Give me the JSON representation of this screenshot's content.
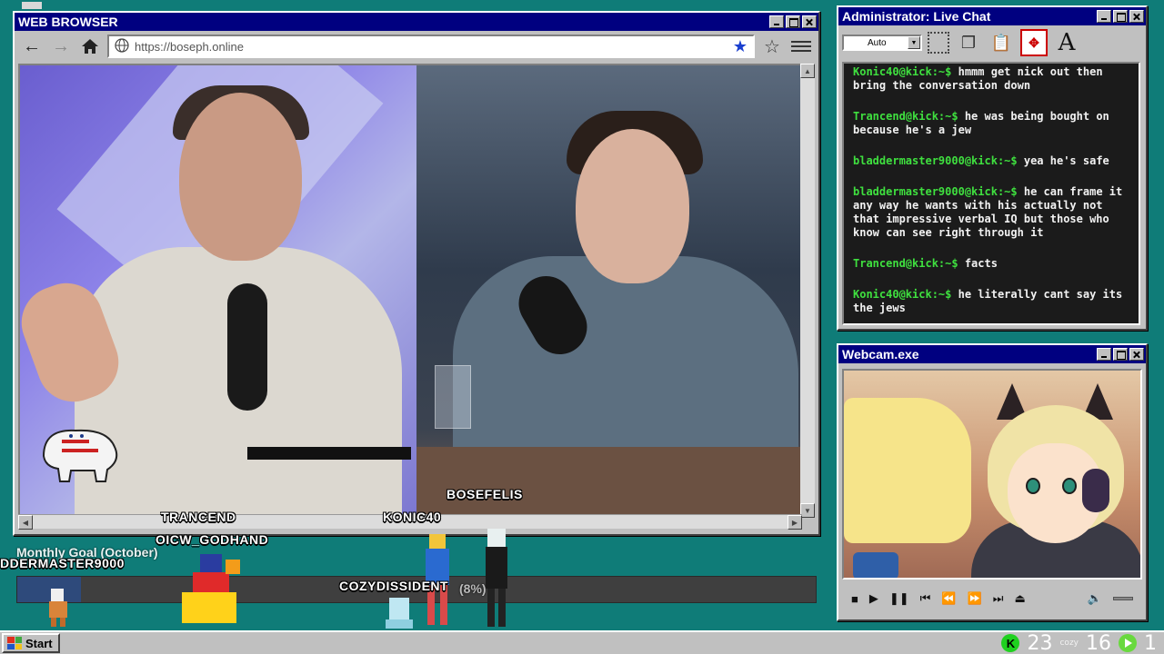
{
  "browser": {
    "title": "WEB BROWSER",
    "url": "https://boseph.online",
    "icons": {
      "back": "arrow-left-icon",
      "forward": "arrow-right-icon",
      "home": "home-icon",
      "globe": "globe-icon",
      "bookmark": "star-filled-icon",
      "favorite": "star-outline-icon",
      "menu": "hamburger-menu-icon"
    }
  },
  "stream": {
    "names": {
      "bosefelis": "BOSEFELIS",
      "trancend": "TRANCEND",
      "konic40": "KONIC40",
      "oicw_godhand": "OICW_GODHAND",
      "bladdermaster": "DDERMASTER9000",
      "cozydissident": "COZYDISSIDENT"
    },
    "goal": {
      "label": "Monthly Goal (October)",
      "percent_text": "(8%)",
      "percent": 8
    }
  },
  "chat": {
    "title": "Administrator: Live Chat",
    "font_size_select": "Auto",
    "tools": [
      "select-marquee-icon",
      "copy-icon",
      "paste-icon",
      "move-icon",
      "font-icon"
    ],
    "font_icon_text": "A",
    "messages": [
      {
        "user": "Konic40@kick:~$",
        "text": "hmmm get nick out then bring the conversation down"
      },
      {
        "user": "Trancend@kick:~$",
        "text": "he was being bought on because he's a jew"
      },
      {
        "user": "bladdermaster9000@kick:~$",
        "text": "yea he's safe"
      },
      {
        "user": "bladdermaster9000@kick:~$",
        "text": "he can frame it any way he wants with his actually not that impressive verbal IQ but those who know can see right through it"
      },
      {
        "user": "Trancend@kick:~$",
        "text": "facts"
      },
      {
        "user": "Konic40@kick:~$",
        "text": "he literally cant say its the jews"
      }
    ]
  },
  "webcam": {
    "title": "Webcam.exe",
    "controls": [
      "stop-icon",
      "play-icon",
      "pause-icon",
      "skip-start-icon",
      "rewind-icon",
      "fast-forward-icon",
      "skip-end-icon",
      "eject-icon",
      "volume-icon"
    ]
  },
  "taskbar": {
    "start_label": "Start",
    "kick_icon_text": "K",
    "kick_count": "23",
    "cozy_label": "cozy",
    "cozy_count": "16",
    "play_count": "1"
  }
}
